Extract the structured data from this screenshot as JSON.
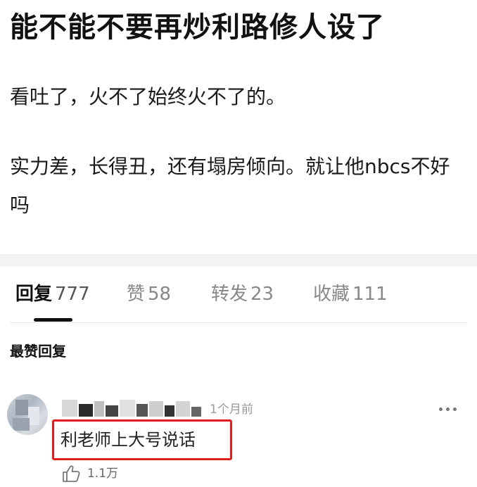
{
  "post": {
    "title": "能不能不要再炒利路修人设了",
    "paragraphs": [
      "看吐了，火不了始终火不了的。",
      "实力差，长得丑，还有塌房倾向。就让他nbcs不好吗"
    ]
  },
  "tabs": [
    {
      "label": "回复",
      "count": "777",
      "active": true
    },
    {
      "label": "赞",
      "count": "58",
      "active": false
    },
    {
      "label": "转发",
      "count": "23",
      "active": false
    },
    {
      "label": "收藏",
      "count": "111",
      "active": false
    }
  ],
  "section_title": "最赞回复",
  "comment": {
    "time": "1个月前",
    "text": "利老师上大号说话",
    "likes": "1.1万",
    "highlight_color": "#e01e1e"
  },
  "icons": {
    "more": "more-dots-icon",
    "like": "thumbs-up-icon"
  }
}
